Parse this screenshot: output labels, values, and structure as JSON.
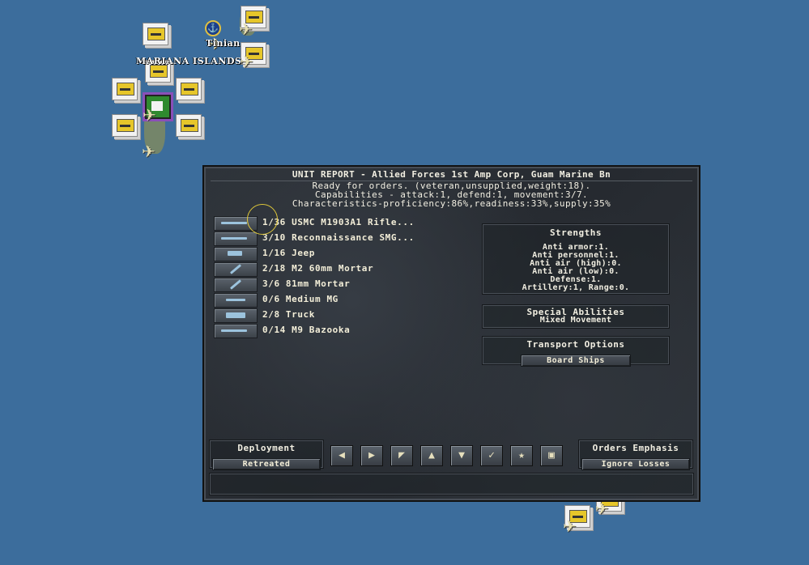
{
  "map": {
    "labels": {
      "region": "MARIANA ISLANDS",
      "town": "Tinian"
    }
  },
  "unit_report": {
    "title": "UNIT REPORT - Allied Forces 1st Amp Corp, Guam Marine Bn",
    "status": "Ready for orders. (veteran,unsupplied,weight:18).",
    "capabilities": "Capabilities - attack:1, defend:1, movement:3/7.",
    "characteristics": "Characteristics-proficiency:86%,readiness:33%,supply:35%",
    "equipment": [
      {
        "text": "1/36 USMC M1903A1 Rifle...",
        "icon": "rifle-icon"
      },
      {
        "text": "3/10 Reconnaissance SMG...",
        "icon": "smg-icon"
      },
      {
        "text": "1/16 Jeep",
        "icon": "jeep-icon"
      },
      {
        "text": "2/18 M2 60mm Mortar",
        "icon": "mortar-icon"
      },
      {
        "text": "3/6 81mm Mortar",
        "icon": "mortar-icon"
      },
      {
        "text": "0/6 Medium MG",
        "icon": "machine-gun-icon"
      },
      {
        "text": "2/8 Truck",
        "icon": "truck-icon"
      },
      {
        "text": "0/14 M9 Bazooka",
        "icon": "bazooka-icon"
      }
    ],
    "strengths": {
      "title": "Strengths",
      "lines": [
        "Anti armor:1.",
        "Anti personnel:1.",
        "Anti air (high):0.",
        "Anti air (low):0.",
        "Defense:1.",
        "Artillery:1, Range:0."
      ]
    },
    "special_abilities": {
      "title": "Special Abilities",
      "value": "Mixed Movement"
    },
    "transport": {
      "title": "Transport Options",
      "button": "Board Ships"
    },
    "deployment": {
      "label": "Deployment",
      "value": "Retreated"
    },
    "orders": {
      "label": "Orders Emphasis",
      "value": "Ignore Losses"
    },
    "commands": [
      {
        "icon": "arrow-left-icon",
        "glyph": "◀"
      },
      {
        "icon": "arrow-right-icon",
        "glyph": "▶"
      },
      {
        "icon": "arrow-up-left-icon",
        "glyph": "◤"
      },
      {
        "icon": "arrow-up-icon",
        "glyph": "▲"
      },
      {
        "icon": "arrow-down-icon",
        "glyph": "▼"
      },
      {
        "icon": "checkmark-icon",
        "glyph": "✓"
      },
      {
        "icon": "star-icon",
        "glyph": "★"
      },
      {
        "icon": "stack-icon",
        "glyph": "▣"
      }
    ]
  }
}
